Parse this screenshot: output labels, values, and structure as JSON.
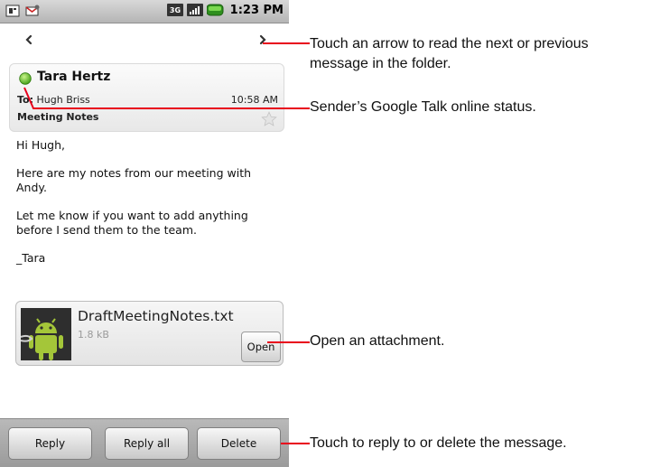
{
  "statusbar": {
    "time": "1:23 PM",
    "icons": [
      "sim-card-icon",
      "gmail-notification-icon",
      "3g-icon",
      "signal-icon",
      "battery-icon"
    ]
  },
  "nav": {
    "prev_icon": "chevron-left-icon",
    "next_icon": "chevron-right-icon"
  },
  "message": {
    "sender": "Tara Hertz",
    "presence": "online",
    "to_label": "To:",
    "to_name": "Hugh Briss",
    "time": "10:58 AM",
    "subject": "Meeting Notes",
    "starred": false,
    "body": [
      "Hi Hugh,",
      "Here are my notes from our meeting with Andy.",
      "Let me know if you want to add anything before I send them to the team.",
      "_Tara"
    ]
  },
  "attachment": {
    "name": "DraftMeetingNotes.txt",
    "size": "1.8 kB",
    "open_label": "Open"
  },
  "actions": {
    "reply": "Reply",
    "reply_all": "Reply all",
    "delete": "Delete"
  },
  "callouts": {
    "arrows": "Touch an arrow to read the next or previous message in the folder.",
    "status": "Sender’s Google Talk online status.",
    "attachment": "Open an attachment.",
    "actions": "Touch to reply to or delete the message."
  },
  "colors": {
    "callout_line": "#e8001c",
    "presence_green": "#5fbf24",
    "bar_gray": "#a8a8a8"
  }
}
